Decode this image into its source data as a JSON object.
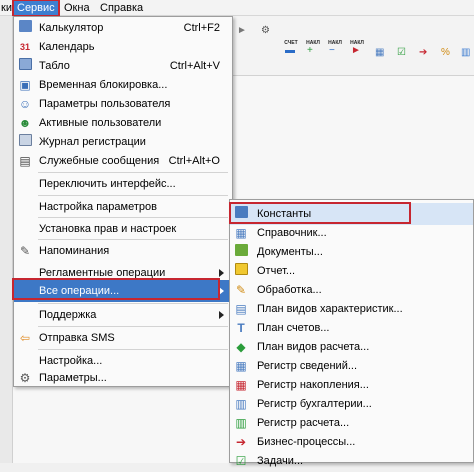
{
  "menubar": {
    "items": [
      "ки",
      "Сервис",
      "Окна",
      "Справка"
    ]
  },
  "toolbar": {
    "buttons": [
      {
        "label": "",
        "icon": "arrow-right-icon"
      },
      {
        "label": "",
        "icon": "gear-icon"
      },
      {
        "label": "СЧЕТ",
        "icon": "invoice-icon"
      },
      {
        "label": "НАКЛ",
        "icon": "invoice-plus-icon"
      },
      {
        "label": "НАКЛ",
        "icon": "invoice-minus-icon"
      },
      {
        "label": "НАКЛ",
        "icon": "invoice-arrow-icon"
      },
      {
        "label": "",
        "icon": "document-grid-icon"
      },
      {
        "label": "",
        "icon": "checklist-icon"
      },
      {
        "label": "",
        "icon": "document-arrow-icon"
      },
      {
        "label": "",
        "icon": "document-percent-icon"
      },
      {
        "label": "",
        "icon": "chart-icon"
      }
    ]
  },
  "service_menu": {
    "items": [
      {
        "label": "Калькулятор",
        "shortcut": "Ctrl+F2",
        "icon": "calculator-icon"
      },
      {
        "label": "Календарь",
        "shortcut": "",
        "icon": "calendar-icon"
      },
      {
        "label": "Табло",
        "shortcut": "Ctrl+Alt+V",
        "icon": "scoreboard-icon"
      },
      {
        "label": "Временная блокировка...",
        "shortcut": "",
        "icon": "lock-icon"
      },
      {
        "label": "Параметры пользователя",
        "shortcut": "",
        "icon": "user-settings-icon"
      },
      {
        "label": "Активные пользователи",
        "shortcut": "",
        "icon": "users-icon"
      },
      {
        "label": "Журнал регистрации",
        "shortcut": "",
        "icon": "journal-icon"
      },
      {
        "label": "Служебные сообщения",
        "shortcut": "Ctrl+Alt+O",
        "icon": "messages-icon"
      },
      {
        "label": "Переключить интерфейс...",
        "shortcut": "",
        "icon": ""
      },
      {
        "label": "Настройка параметров",
        "shortcut": "",
        "icon": ""
      },
      {
        "label": "Установка прав и настроек",
        "shortcut": "",
        "icon": ""
      },
      {
        "label": "Напоминания",
        "shortcut": "",
        "icon": "reminder-icon"
      },
      {
        "label": "Регламентные операции",
        "shortcut": "",
        "icon": ""
      },
      {
        "label": "Все операции...",
        "shortcut": "",
        "icon": ""
      },
      {
        "label": "Поддержка",
        "shortcut": "",
        "icon": ""
      },
      {
        "label": "Отправка SMS",
        "shortcut": "",
        "icon": "sms-icon"
      },
      {
        "label": "Настройка...",
        "shortcut": "",
        "icon": ""
      },
      {
        "label": "Параметры...",
        "shortcut": "",
        "icon": "parameters-icon"
      }
    ]
  },
  "operations_menu": {
    "items": [
      {
        "label": "Константы",
        "icon": "constants-icon"
      },
      {
        "label": "Справочник...",
        "icon": "catalog-icon"
      },
      {
        "label": "Документы...",
        "icon": "documents-icon"
      },
      {
        "label": "Отчет...",
        "icon": "report-icon"
      },
      {
        "label": "Обработка...",
        "icon": "processing-icon"
      },
      {
        "label": "План видов характеристик...",
        "icon": "characteristics-plan-icon"
      },
      {
        "label": "План счетов...",
        "icon": "accounts-plan-icon"
      },
      {
        "label": "План видов расчета...",
        "icon": "calculation-plan-icon"
      },
      {
        "label": "Регистр сведений...",
        "icon": "info-register-icon"
      },
      {
        "label": "Регистр накопления...",
        "icon": "accumulation-register-icon"
      },
      {
        "label": "Регистр бухгалтерии...",
        "icon": "accounting-register-icon"
      },
      {
        "label": "Регистр расчета...",
        "icon": "calculation-register-icon"
      },
      {
        "label": "Бизнес-процессы...",
        "icon": "business-process-icon"
      },
      {
        "label": "Задачи...",
        "icon": "tasks-icon"
      }
    ]
  },
  "colors": {
    "highlight": "#3d78c6",
    "annotation": "#c62630",
    "submenu_highlight": "#d7e5f6"
  }
}
